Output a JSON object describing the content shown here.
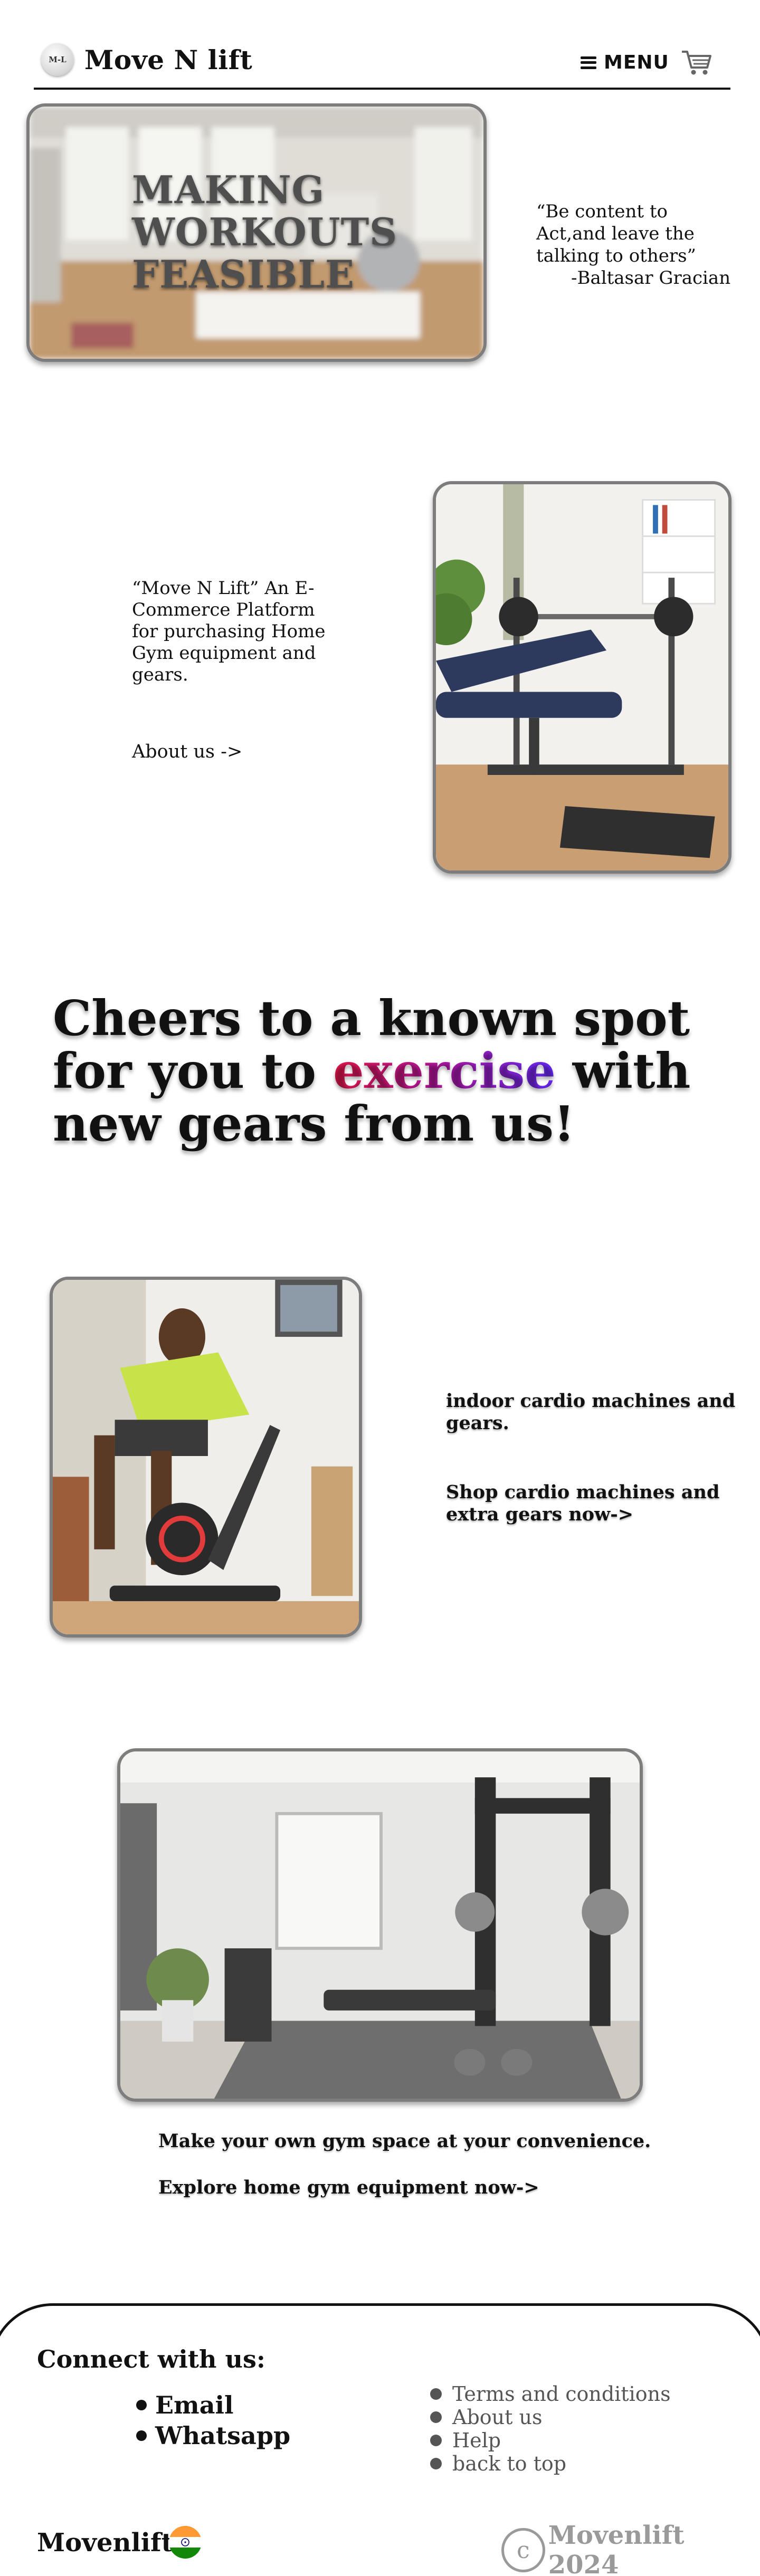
{
  "header": {
    "logo_text": "M-L",
    "brand": "Move N lift",
    "menu_label": "MENU",
    "menu_icon": "hamburger-icon",
    "cart_icon": "shopping-cart-icon"
  },
  "hero": {
    "title_lines": [
      "MAKING",
      "WORKOUTS",
      "FEASIBLE"
    ],
    "quote_text": "“Be content to Act,and leave the talking to others”",
    "quote_author": "-Baltasar Gracian"
  },
  "about": {
    "text": "“Move N Lift” An E-Commerce Platform for purchasing Home Gym equipment and gears.",
    "link": "About us ->"
  },
  "heading": {
    "part1": "Cheers to a known spot for you to",
    "accent": "exercise",
    "part2": "with new gears from us!",
    "accent_colors": [
      "#e8174b",
      "#6a2bff"
    ]
  },
  "cardio": {
    "text": "indoor cardio machines and gears.",
    "link": "Shop cardio machines and extra gears now->"
  },
  "gym": {
    "text": "Make your own gym space at your convenience.",
    "link": "Explore home gym equipment now->"
  },
  "footer": {
    "connect_title": "Connect with us:",
    "connect_items": [
      "Email",
      "Whatsapp"
    ],
    "links": [
      "Terms and conditions",
      "About us",
      "Help",
      "back to top"
    ],
    "brand": "Movenlift",
    "flag_icon": "india-flag-icon",
    "copyright_symbol": "c",
    "copyright_text": "Movenlift 2024"
  }
}
